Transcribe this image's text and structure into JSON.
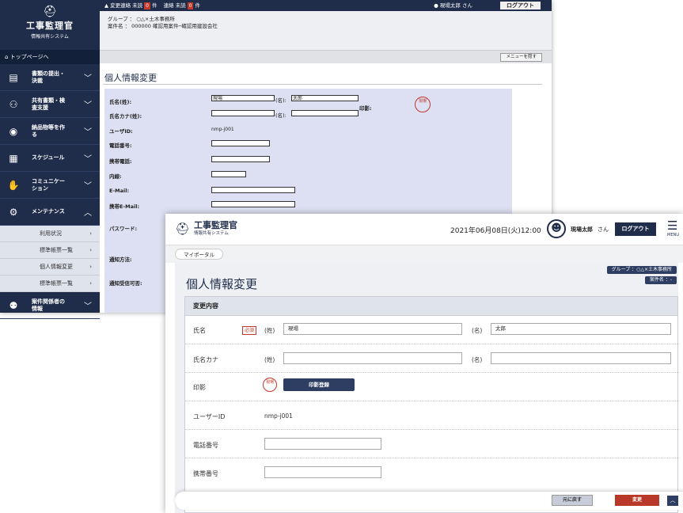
{
  "old": {
    "logo": {
      "title": "工事監理官",
      "subtitle": "情報共有システム"
    },
    "top_link": "トップページへ",
    "sidebar_items": [
      {
        "icon": "document-icon",
        "label": "書類の提出・決裁"
      },
      {
        "icon": "people-icon",
        "label": "共有書類・検査支援"
      },
      {
        "icon": "deliverable-icon",
        "label": "納品物等を作る"
      },
      {
        "icon": "calendar-icon",
        "label": "スケジュール"
      },
      {
        "icon": "handshake-icon",
        "label": "コミュニケーション"
      },
      {
        "icon": "gear-icon",
        "label": "メンテナンス"
      }
    ],
    "sub_items": [
      "利用状況",
      "標準帳票一覧",
      "個人情報変更",
      "標準帳票一覧"
    ],
    "last_item": "案件関係者の情報",
    "topbar": {
      "alert1": "変更連絡 未読",
      "count1": "0",
      "unit1": "件",
      "alert2": "連絡 未読",
      "count2": "0",
      "unit2": "件",
      "user": "現場太郎 さん",
      "logout": "ログアウト"
    },
    "info": {
      "group": "グループ ： ○△×土木事務所",
      "case": "案件名 ： 000000 確認用案件─確認用建設会社"
    },
    "menu_button": "メニューを隠す",
    "page_title": "個人情報変更",
    "form": {
      "name_label": "氏名(姓):",
      "name_last": "現場",
      "name_first_label": "(名):",
      "name_first": "太郎",
      "stamp_label": "印影:",
      "stamp_text": "現場",
      "kana_label": "氏名カナ(姓):",
      "kana_first_label": "(名):",
      "userid_label": "ユーザID:",
      "userid": "nmp-j001",
      "phone_label": "電話番号:",
      "mobile_label": "携帯電話:",
      "ext_label": "内線:",
      "email_label": "E-Mail:",
      "mobile_email_label": "携帯E-Mail:",
      "password_label": "パスワード:",
      "notify_label": "通知方法:",
      "notify_time_label": "通知受信可否:"
    }
  },
  "new": {
    "logo": {
      "title": "工事監理官",
      "subtitle": "情報共有システム"
    },
    "datetime": "2021年06月08日(火)12:00",
    "user": "現場太郎",
    "user_suffix": "さん",
    "logout": "ログアウト",
    "menu": "MENU",
    "breadcrumb": "マイポータル",
    "group": "グループ ：○△×土木事務所",
    "case": "案件名 ：-",
    "page_title": "個人情報変更",
    "card_title": "変更内容",
    "name_label": "氏名",
    "required": "必須",
    "last_paren": "(姓)",
    "first_paren": "(名)",
    "name_last": "現場",
    "name_first": "太郎",
    "kana_label": "氏名カナ",
    "stamp_label": "印影",
    "stamp_text": "現場",
    "stamp_button": "印影登録",
    "userid_label": "ユーザーID",
    "userid": "nmp-j001",
    "phone_label": "電話番号",
    "mobile_label": "携帯番号",
    "back_button": "元に戻す",
    "change_button": "変更"
  },
  "colors": {
    "navy": "#1f2d4b",
    "red": "#c0392b",
    "form_bg": "#dde0f2"
  }
}
